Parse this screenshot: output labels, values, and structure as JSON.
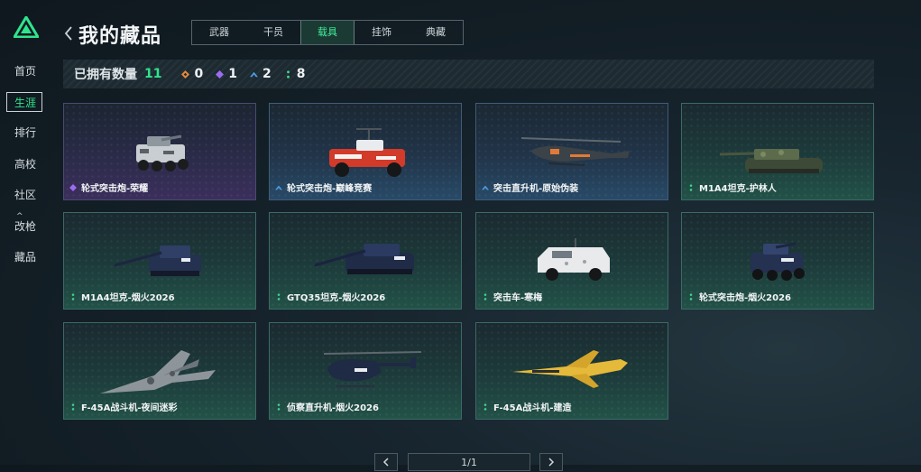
{
  "sidebar": {
    "items": [
      {
        "label": "首页"
      },
      {
        "label": "生涯",
        "active": true
      },
      {
        "label": "排行"
      },
      {
        "label": "高校"
      },
      {
        "label": "社区",
        "caret": "^"
      },
      {
        "label": "改枪"
      },
      {
        "label": "藏品"
      }
    ]
  },
  "header": {
    "title": "我的藏品",
    "tabs": [
      {
        "label": "武器"
      },
      {
        "label": "干员"
      },
      {
        "label": "载具",
        "active": true
      },
      {
        "label": "挂饰"
      },
      {
        "label": "典藏"
      }
    ]
  },
  "summary": {
    "owned_label": "已拥有数量",
    "owned_count": "11",
    "rarities": [
      {
        "icon": "orange-diamond-icon",
        "color": "#e58a3c",
        "count": "0"
      },
      {
        "icon": "purple-diamond-icon",
        "color": "#9b6cf0",
        "count": "1"
      },
      {
        "icon": "blue-chevron-icon",
        "color": "#4f9de8",
        "count": "2"
      },
      {
        "icon": "green-dots-icon",
        "color": "#3fd68a",
        "count": "8"
      }
    ]
  },
  "cards": [
    {
      "label": "轮式突击炮-荣耀",
      "rarity": "purple",
      "vehicle": "wheeled-assault-vehicle"
    },
    {
      "label": "轮式突击炮-巅峰竞赛",
      "rarity": "blue",
      "vehicle": "wheeled-assault-vehicle-red"
    },
    {
      "label": "突击直升机-原始伪装",
      "rarity": "blue",
      "vehicle": "attack-helicopter"
    },
    {
      "label": "M1A4坦克-护林人",
      "rarity": "green",
      "vehicle": "tank-camo"
    },
    {
      "label": "M1A4坦克-烟火2026",
      "rarity": "green",
      "vehicle": "tank-blue"
    },
    {
      "label": "GTQ35坦克-烟火2026",
      "rarity": "green",
      "vehicle": "tank-blue-2"
    },
    {
      "label": "突击车-寒梅",
      "rarity": "green",
      "vehicle": "armored-car-white"
    },
    {
      "label": "轮式突击炮-烟火2026",
      "rarity": "green",
      "vehicle": "wheeled-assault-vehicle-blue"
    },
    {
      "label": "F-45A战斗机-夜间迷彩",
      "rarity": "green",
      "vehicle": "fighter-jet-camo"
    },
    {
      "label": "侦察直升机-烟火2026",
      "rarity": "green",
      "vehicle": "scout-helicopter"
    },
    {
      "label": "F-45A战斗机-建造",
      "rarity": "green",
      "vehicle": "fighter-jet-yellow"
    }
  ],
  "pagination": {
    "text": "1/1"
  }
}
